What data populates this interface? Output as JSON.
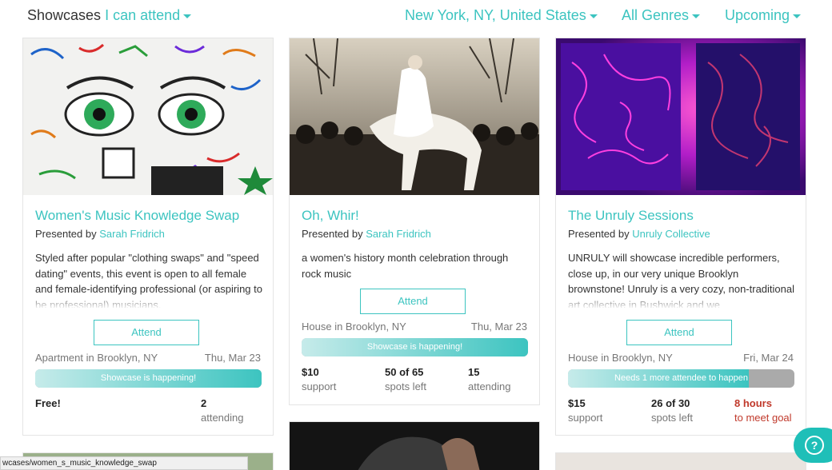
{
  "header": {
    "title": "Showcases",
    "filter_attend": "I can attend",
    "location": "New York, NY, United States",
    "genre": "All Genres",
    "timeframe": "Upcoming"
  },
  "cards": [
    {
      "title": "Women's Music Knowledge Swap",
      "presented_prefix": "Presented by",
      "presenter": "Sarah Fridrich",
      "description": "Styled after popular \"clothing swaps\" and \"speed dating\" events, this event is open to all female and female-identifying professional (or aspiring to be professional) musicians.",
      "attend_label": "Attend",
      "venue": "Apartment in Brooklyn, NY",
      "date": "Thu, Mar 23",
      "status": "Showcase is happening!",
      "progress": 1.0,
      "stats": [
        {
          "value": "Free!",
          "label": ""
        },
        {
          "value": "2",
          "label": "attending"
        }
      ]
    },
    {
      "title": "Oh, Whir!",
      "presented_prefix": "Presented by",
      "presenter": "Sarah Fridrich",
      "description": "a women's history month celebration through rock music",
      "attend_label": "Attend",
      "venue": "House in Brooklyn, NY",
      "date": "Thu, Mar 23",
      "status": "Showcase is happening!",
      "progress": 1.0,
      "stats": [
        {
          "value": "$10",
          "label": "support"
        },
        {
          "value": "50 of 65",
          "label": "spots left"
        },
        {
          "value": "15",
          "label": "attending"
        }
      ]
    },
    {
      "title": "The Unruly Sessions",
      "presented_prefix": "Presented by",
      "presenter": "Unruly Collective",
      "description": "UNRULY will showcase incredible performers, close up, in our very unique Brooklyn brownstone!  Unruly is a very cozy, non-traditional art collective in Bushwick and we",
      "attend_label": "Attend",
      "venue": "House in Brooklyn, NY",
      "date": "Fri, Mar 24",
      "status": "Needs 1 more attendee to happen",
      "progress": 0.8,
      "stats": [
        {
          "value": "$15",
          "label": "support"
        },
        {
          "value": "26 of 30",
          "label": "spots left"
        },
        {
          "value": "8 hours",
          "label": "to meet goal"
        }
      ]
    }
  ],
  "status_url": "wcases/women_s_music_knowledge_swap",
  "help_glyph": "?",
  "colors": {
    "accent": "#3cc4c0",
    "alert": "#c0392b",
    "bar_empty": "#aaaaaa"
  },
  "icons": {
    "help": "help-icon",
    "dropdown": "chevron-down-icon"
  }
}
